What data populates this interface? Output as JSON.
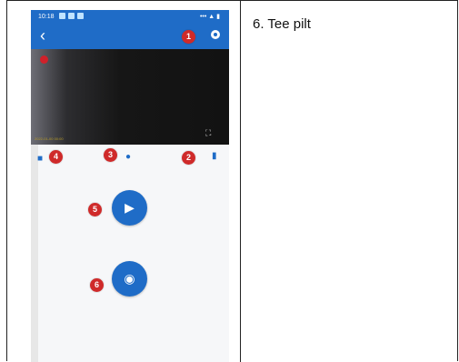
{
  "caption": "6. Tee pilt",
  "phone": {
    "status_time": "10:18",
    "status_right": "••• ▲ ▮",
    "back_glyph": "‹",
    "timestamp": "2022-01-00 00:00",
    "fullscreen_glyph": "⛶",
    "badges": [
      "1",
      "2",
      "3",
      "4",
      "5",
      "6"
    ],
    "icons": {
      "settings": "gear-icon",
      "snapshot_small": "camera-icon",
      "microphone": "microphone-icon",
      "sdcard": "sd-card-icon",
      "record": "video-record-icon",
      "photo": "camera-icon"
    }
  }
}
